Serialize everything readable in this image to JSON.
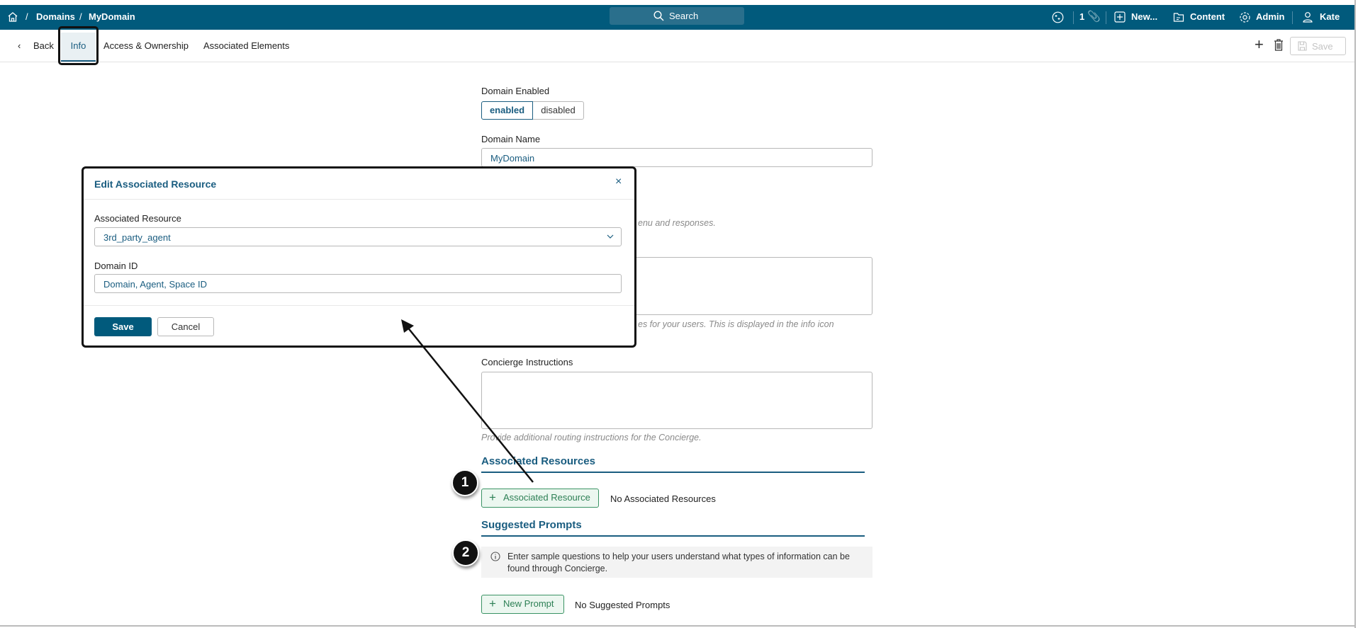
{
  "topbar": {
    "breadcrumb": [
      "/",
      "Domains",
      "/",
      "MyDomain"
    ],
    "search_label": "Search",
    "attachment_count": "1",
    "new_label": "New...",
    "content_label": "Content",
    "admin_label": "Admin",
    "user_name": "Kate",
    "color": "#015a7c"
  },
  "tabs": {
    "back": "Back",
    "items": [
      "Info",
      "Access & Ownership",
      "Associated Elements"
    ],
    "active": "Info",
    "save_label": "Save"
  },
  "form": {
    "domain_enabled_label": "Domain Enabled",
    "toggle_options": [
      "enabled",
      "disabled"
    ],
    "toggle_selected": "enabled",
    "domain_name_label": "Domain Name",
    "domain_name_value": "MyDomain",
    "help_fragment_1": "enu and responses.",
    "help_fragment_2": "es for your users. This is displayed in the info icon",
    "concierge_label": "Concierge Instructions",
    "concierge_help": "Provide additional routing instructions for the Concierge.",
    "associated_heading": "Associated Resources",
    "add_resource_label": "Associated Resource",
    "no_resources": "No Associated Resources",
    "prompts_heading": "Suggested Prompts",
    "prompts_info": "Enter sample questions to help your users understand what types of information can be found through Concierge.",
    "new_prompt_label": "New Prompt",
    "no_prompts": "No Suggested Prompts"
  },
  "dialog": {
    "title": "Edit Associated Resource",
    "resource_label": "Associated Resource",
    "resource_value": "3rd_party_agent",
    "domain_id_label": "Domain ID",
    "domain_id_value": "Domain, Agent, Space ID",
    "save_label": "Save",
    "cancel_label": "Cancel"
  },
  "annotations": [
    "1",
    "2"
  ]
}
